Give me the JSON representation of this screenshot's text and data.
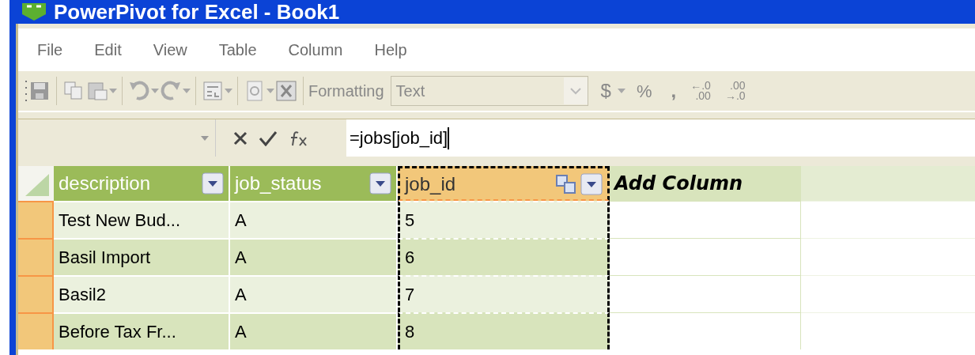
{
  "window": {
    "title": "PowerPivot for Excel - Book1"
  },
  "menu": [
    "File",
    "Edit",
    "View",
    "Table",
    "Column",
    "Help"
  ],
  "toolbar": {
    "formatting_label": "Formatting",
    "format_combo": {
      "value": "Text",
      "disabled": true
    },
    "currency": "$",
    "percent": "%",
    "comma": ",",
    "decimals": [
      {
        "top": "←.0",
        "bottom": ".00"
      },
      {
        "top": ".00",
        "bottom": "→.0"
      }
    ]
  },
  "formula_bar": {
    "formula": "=jobs[job_id]"
  },
  "table": {
    "columns": [
      {
        "label": "description",
        "kind": "data",
        "selected": false
      },
      {
        "label": "job_status",
        "kind": "data",
        "selected": false
      },
      {
        "label": "job_id",
        "kind": "data",
        "selected": true
      },
      {
        "label": "Add Column",
        "kind": "add",
        "selected": false
      }
    ],
    "rows": [
      [
        "Test New Bud...",
        "A",
        "5"
      ],
      [
        "Basil Import",
        "A",
        "6"
      ],
      [
        "Basil2",
        "A",
        "7"
      ],
      [
        "Before Tax Fr...",
        "A",
        "8"
      ]
    ]
  }
}
